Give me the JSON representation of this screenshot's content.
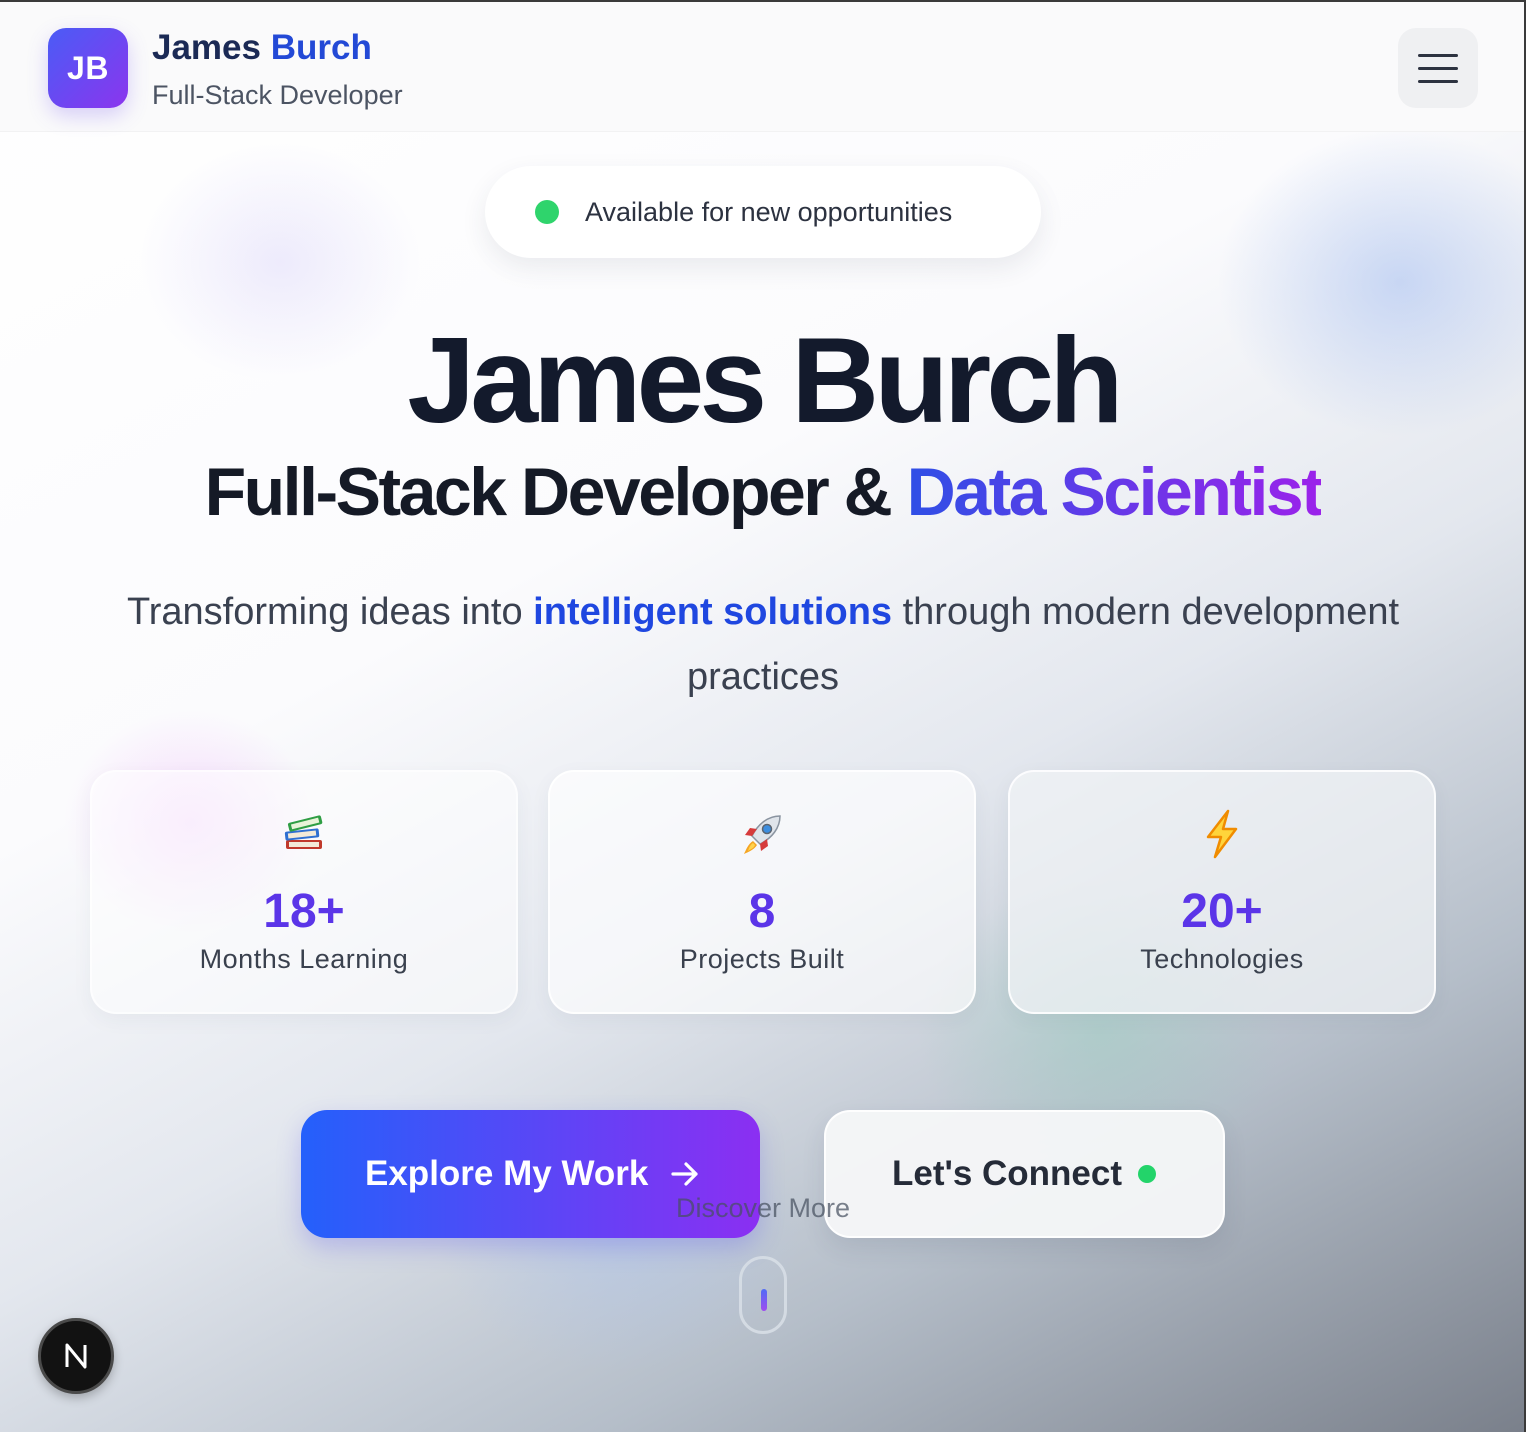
{
  "header": {
    "logo_initials": "JB",
    "name_first": "James",
    "name_last": "Burch",
    "role": "Full-Stack Developer",
    "menu_icon": "hamburger-menu-icon"
  },
  "availability": {
    "text": "Available for new opportunities",
    "status_color": "#2fd46c"
  },
  "hero": {
    "name": "James Burch",
    "role_prefix": "Full-Stack Developer & ",
    "role_accent": "Data Scientist",
    "tagline_prefix": "Transforming ideas into ",
    "tagline_highlight": "intelligent solutions",
    "tagline_suffix": " through modern development practices"
  },
  "stats": [
    {
      "icon": "books-icon",
      "value": "18+",
      "label": "Months Learning"
    },
    {
      "icon": "rocket-icon",
      "value": "8",
      "label": "Projects Built"
    },
    {
      "icon": "lightning-icon",
      "value": "20+",
      "label": "Technologies"
    }
  ],
  "cta": {
    "primary_label": "Explore My Work",
    "primary_icon": "arrow-right-icon",
    "secondary_label": "Let's Connect",
    "secondary_status_color": "#23d46a"
  },
  "scroll_hint": {
    "text": "Discover More",
    "icon": "mouse-scroll-icon"
  },
  "dev_badge": {
    "letter": "N"
  },
  "colors": {
    "accent_blue": "#2349d6",
    "accent_purple": "#8b2ff2",
    "stat_number": "#5b35e8"
  }
}
